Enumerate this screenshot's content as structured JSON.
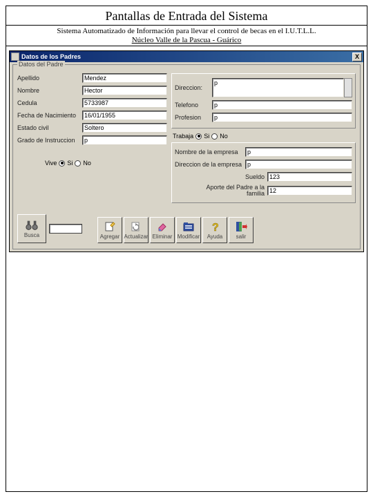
{
  "page": {
    "title": "Pantallas de Entrada del Sistema",
    "subtitle": "Sistema Automatizado de Información para llevar el control de becas en el I.U.T.L.L.",
    "subtitle2": "Núcleo Valle de la Pascua - Guárico"
  },
  "window": {
    "title": "Datos de los Padres",
    "close": "X"
  },
  "groupbox": {
    "title": "Datos del Padre"
  },
  "left": {
    "apellido_label": "Apellido",
    "apellido_value": "Mendez",
    "nombre_label": "Nombre",
    "nombre_value": "Hector",
    "cedula_label": "Cedula",
    "cedula_value": "5733987",
    "fechanac_label": "Fecha de Nacimiento",
    "fechanac_value": "16/01/1955",
    "estadocivil_label": "Estado civil",
    "estadocivil_value": "Soltero",
    "gradoinst_label": "Grado de Instruccion",
    "gradoinst_value": "p"
  },
  "vive": {
    "label": "Vive",
    "si": "Si",
    "no": "No"
  },
  "right_top": {
    "direccion_label": "Direccion:",
    "direccion_value": "p",
    "telefono_label": "Telefono",
    "telefono_value": "p",
    "profesion_label": "Profesion",
    "profesion_value": "p"
  },
  "trabaja": {
    "label": "Trabaja",
    "si": "Si",
    "no": "No"
  },
  "right_bottom": {
    "nombre_empresa_label": "Nombre de la empresa",
    "nombre_empresa_value": "p",
    "direccion_empresa_label": "Direccion de la empresa",
    "direccion_empresa_value": "p",
    "sueldo_label": "Sueldo",
    "sueldo_value": "123",
    "aporte_label": "Aporte del Padre a la familia",
    "aporte_value": "12"
  },
  "toolbar": {
    "busca": "Busca",
    "agregar": "Agregar",
    "actualizar": "Actualizar",
    "eliminar": "Eliminar",
    "modificar": "Modificar",
    "ayuda": "Ayuda",
    "salir": "salir"
  }
}
